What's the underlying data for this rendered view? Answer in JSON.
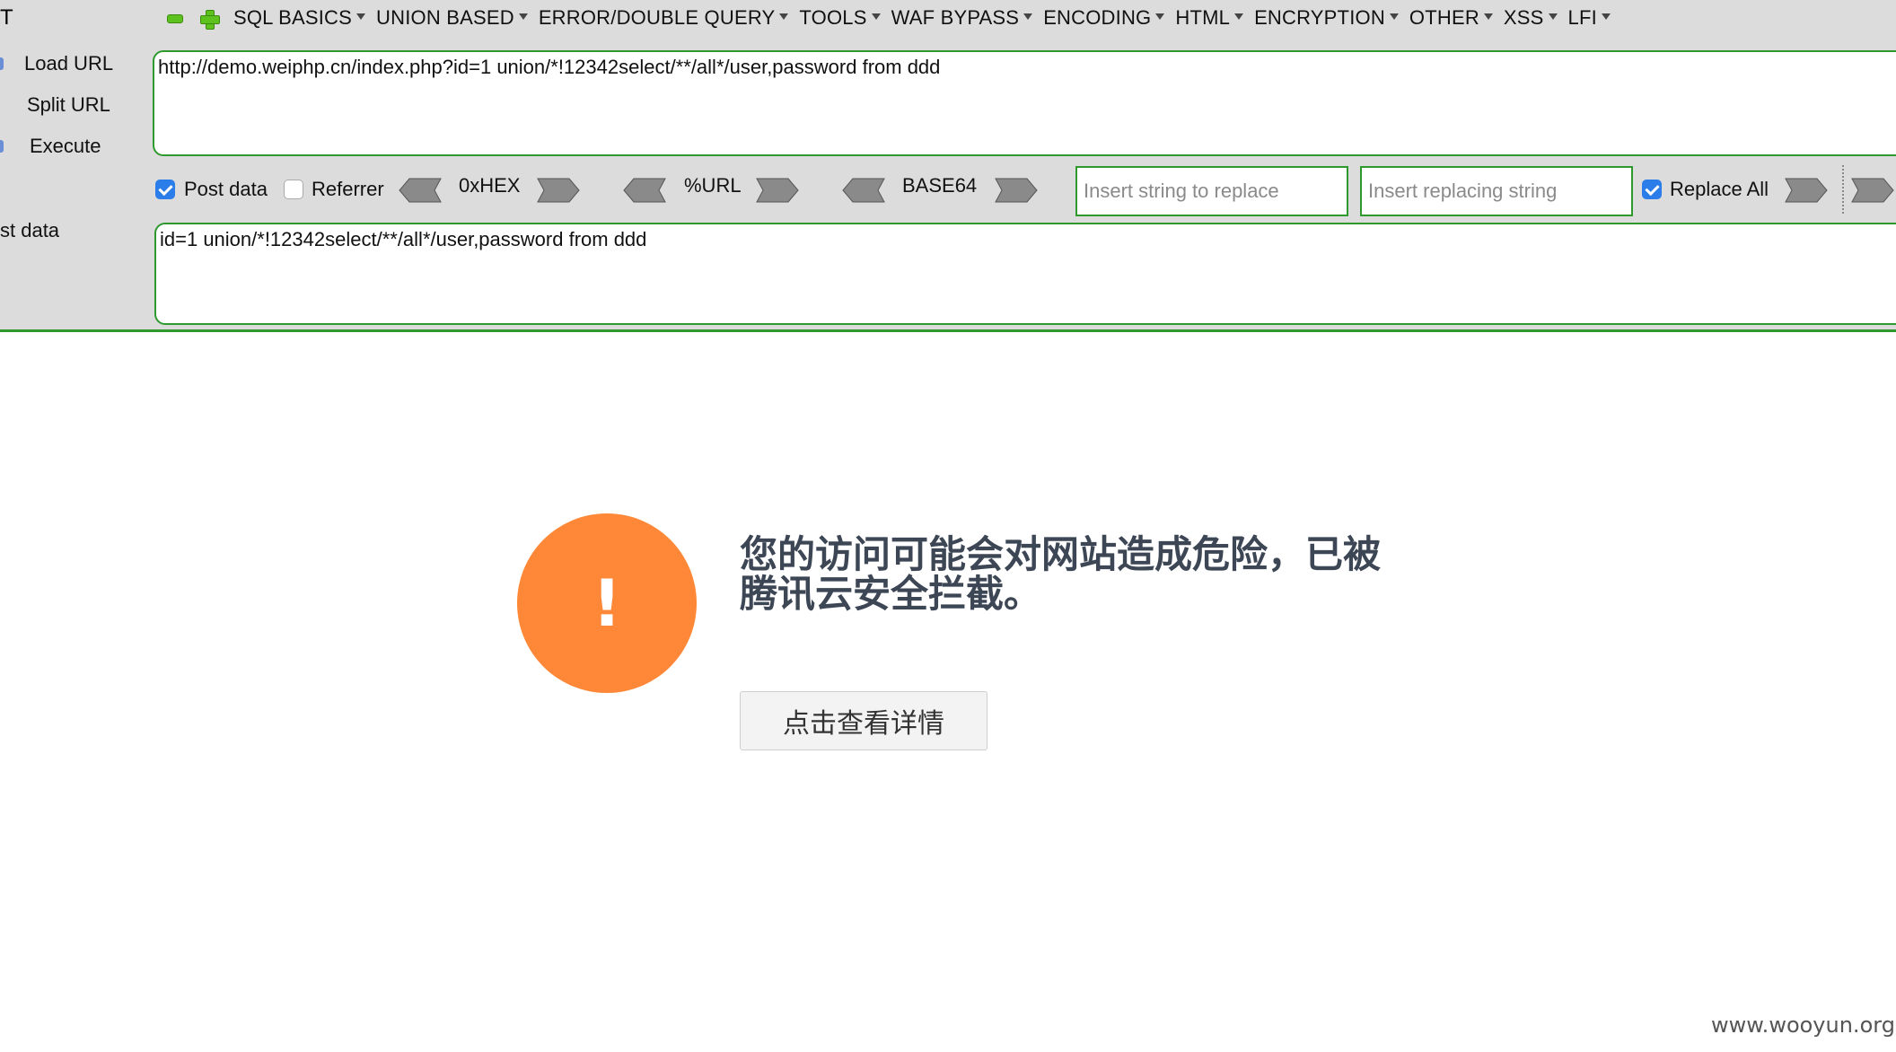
{
  "hackbar": {
    "edge_glyph": "T",
    "menus": [
      {
        "label": "SQL BASICS"
      },
      {
        "label": "UNION BASED"
      },
      {
        "label": "ERROR/DOUBLE QUERY"
      },
      {
        "label": "TOOLS"
      },
      {
        "label": "WAF BYPASS"
      },
      {
        "label": "ENCODING"
      },
      {
        "label": "HTML"
      },
      {
        "label": "ENCRYPTION"
      },
      {
        "label": "OTHER"
      },
      {
        "label": "XSS"
      },
      {
        "label": "LFI"
      }
    ],
    "side_buttons": {
      "load_url": "Load URL",
      "split_url": "Split URL",
      "execute": "Execute",
      "post_data_label": "st data"
    },
    "url_value": "http://demo.weiphp.cn/index.php?id=1 union/*!12342select/**/all*/user,password from ddd",
    "options": {
      "post_data": {
        "label": "Post data",
        "checked": true
      },
      "referrer": {
        "label": "Referrer",
        "checked": false
      },
      "hex_label": "0xHEX",
      "url_label": "%URL",
      "base64_label": "BASE64",
      "replace_from_placeholder": "Insert string to replace",
      "replace_to_placeholder": "Insert replacing string",
      "replace_all": {
        "label": "Replace All",
        "checked": true
      }
    },
    "post_data_value": "id=1 union/*!12342select/**/all*/user,password from ddd",
    "colors": {
      "accent_green": "#2e9a2e",
      "checkbox_blue": "#2b7de9",
      "toolbar_bg": "#dcdcdc"
    }
  },
  "blocked": {
    "icon": "exclamation-icon",
    "icon_glyph": "!",
    "message": "您的访问可能会对网站造成危险，已被腾讯云安全拦截。",
    "detail_button": "点击查看详情",
    "colors": {
      "warning_orange": "#fe8837",
      "message_text": "#3d4654"
    }
  },
  "watermark": "www.wooyun.org"
}
